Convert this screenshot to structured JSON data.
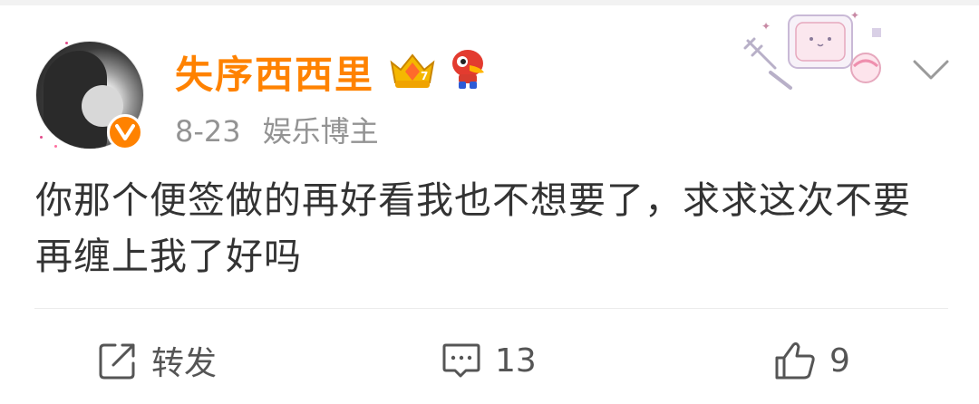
{
  "post": {
    "username": "失序西西里",
    "date": "8-23",
    "user_tag": "娱乐博主",
    "content": "你那个便签做的再好看我也不想要了，求求这次不要再缠上我了好吗"
  },
  "actions": {
    "repost_label": "转发",
    "comment_count": "13",
    "like_count": "9"
  },
  "colors": {
    "accent": "#ff8200",
    "meta_text": "#939393",
    "body_text": "#333333"
  },
  "icons": [
    "avatar",
    "verified-v-icon",
    "crown-badge-icon",
    "mascot-badge-icon",
    "chevron-down-icon",
    "repost-icon",
    "comment-icon",
    "like-icon"
  ]
}
